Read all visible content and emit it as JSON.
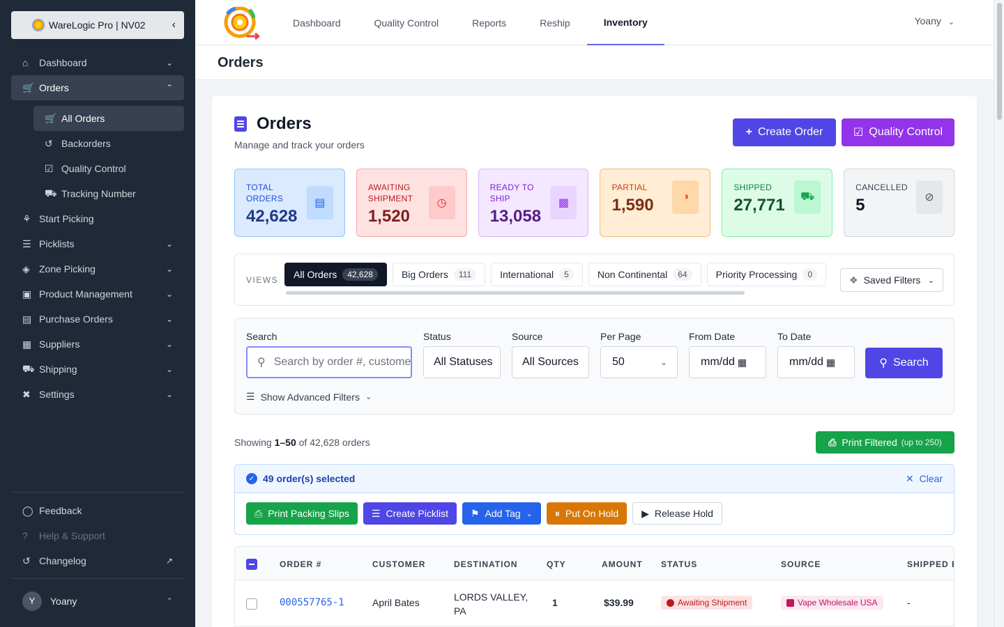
{
  "sidebar": {
    "brand": "WareLogic Pro | NV02",
    "items": [
      {
        "label": "Dashboard",
        "icon": "house-icon"
      },
      {
        "label": "Orders",
        "icon": "cart-icon"
      },
      {
        "label": "Start Picking",
        "icon": "hand-cart-icon"
      },
      {
        "label": "Picklists",
        "icon": "list-icon"
      },
      {
        "label": "Zone Picking",
        "icon": "layers-icon"
      },
      {
        "label": "Product Management",
        "icon": "boxes-icon"
      },
      {
        "label": "Purchase Orders",
        "icon": "file-icon"
      },
      {
        "label": "Suppliers",
        "icon": "warehouse-icon"
      },
      {
        "label": "Shipping",
        "icon": "truck-icon"
      },
      {
        "label": "Settings",
        "icon": "tools-icon"
      }
    ],
    "orders_sub": [
      {
        "label": "All Orders",
        "icon": "cart-icon"
      },
      {
        "label": "Backorders",
        "icon": "history-icon"
      },
      {
        "label": "Quality Control",
        "icon": "clipboard-check-icon"
      },
      {
        "label": "Tracking Number",
        "icon": "truck-fast-icon"
      }
    ],
    "bottom": [
      {
        "label": "Feedback",
        "icon": "comment-icon"
      },
      {
        "label": "Help & Support",
        "icon": "question-icon"
      },
      {
        "label": "Changelog",
        "icon": "history-icon"
      }
    ],
    "user": {
      "initial": "Y",
      "name": "Yoany"
    }
  },
  "topnav": {
    "items": [
      "Dashboard",
      "Quality Control",
      "Reports",
      "Reship",
      "Inventory"
    ],
    "active": "Inventory",
    "user": "Yoany"
  },
  "subheader": {
    "title": "Orders"
  },
  "page": {
    "title": "Orders",
    "subtitle": "Manage and track your orders",
    "create_btn": "Create Order",
    "qc_btn": "Quality Control"
  },
  "stats": [
    {
      "label": "TOTAL ORDERS",
      "value": "42,628"
    },
    {
      "label": "AWAITING SHIPMENT",
      "value": "1,520"
    },
    {
      "label": "READY TO SHIP",
      "value": "13,058"
    },
    {
      "label": "PARTIAL",
      "value": "1,590"
    },
    {
      "label": "SHIPPED",
      "value": "27,771"
    },
    {
      "label": "CANCELLED",
      "value": "5"
    }
  ],
  "views": {
    "label": "VIEWS",
    "tabs": [
      {
        "label": "All Orders",
        "count": "42,628"
      },
      {
        "label": "Big Orders",
        "count": "111"
      },
      {
        "label": "International",
        "count": "5"
      },
      {
        "label": "Non Continental",
        "count": "64"
      },
      {
        "label": "Priority Processing",
        "count": "0"
      }
    ],
    "saved": "Saved Filters"
  },
  "filters": {
    "search_label": "Search",
    "search_placeholder": "Search by order #, customer",
    "status_label": "Status",
    "status_value": "All Statuses",
    "source_label": "Source",
    "source_value": "All Sources",
    "perpage_label": "Per Page",
    "perpage_value": "50",
    "from_label": "From Date",
    "from_value": "mm/dd",
    "to_label": "To Date",
    "to_value": "mm/dd",
    "search_btn": "Search",
    "advanced": "Show Advanced Filters"
  },
  "results": {
    "prefix": "Showing",
    "range": "1–50",
    "suffix": "of 42,628 orders",
    "print_btn": "Print Filtered",
    "print_note": "(up to 250)"
  },
  "bulk": {
    "selected": "49 order(s) selected",
    "clear": "Clear",
    "buttons": [
      "Print Packing Slips",
      "Create Picklist",
      "Add Tag",
      "Put On Hold",
      "Release Hold"
    ]
  },
  "table": {
    "headers": [
      "ORDER #",
      "CUSTOMER",
      "DESTINATION",
      "QTY",
      "AMOUNT",
      "STATUS",
      "SOURCE",
      "SHIPPED B"
    ],
    "rows": [
      {
        "order": "000557765-1",
        "customer": "April Bates",
        "dest_line1": "LORDS VALLEY,",
        "dest_line2": "PA",
        "qty": "1",
        "amount": "$39.99",
        "status": "Awaiting Shipment",
        "source": "Vape Wholesale USA",
        "shipped_by": "-"
      }
    ]
  }
}
